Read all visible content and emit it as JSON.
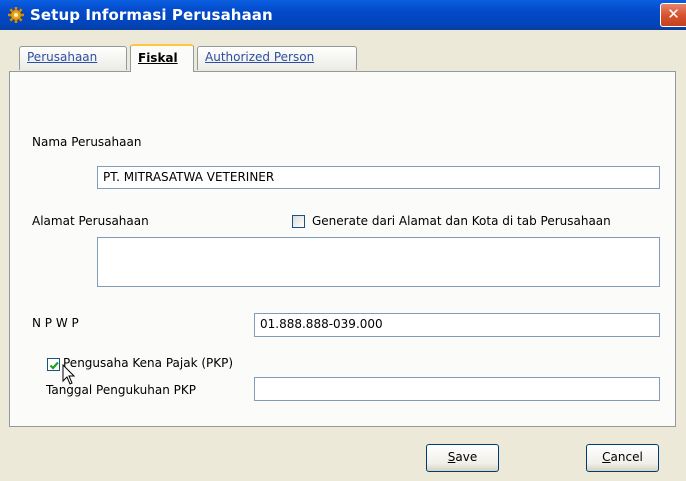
{
  "window": {
    "title": "Setup Informasi Perusahaan",
    "close_glyph": "✕",
    "app_icon": "gear-app-icon"
  },
  "tabs": [
    {
      "label": "Perusahaan",
      "active": false
    },
    {
      "label": "Fiskal",
      "active": true
    },
    {
      "label": "Authorized Person",
      "active": false
    }
  ],
  "form": {
    "nama_label": "Nama Perusahaan",
    "nama_value": "PT. MITRASATWA VETERINER",
    "alamat_label": "Alamat Perusahaan",
    "generate_label": "Generate dari Alamat dan Kota di tab Perusahaan",
    "generate_checked": false,
    "alamat_value": "",
    "npwp_label": "N P W P",
    "npwp_value": "01.888.888-039.000",
    "pkp_label": "Pengusaha Kena Pajak (PKP)",
    "pkp_checked": true,
    "tanggal_label": "Tanggal Pengukuhan PKP",
    "tanggal_value": ""
  },
  "buttons": {
    "save_mnemonic": "S",
    "save_rest": "ave",
    "cancel_mnemonic": "C",
    "cancel_rest": "ancel"
  },
  "colors": {
    "titlebar": "#0348c8",
    "close": "#d5512e",
    "tab_highlight": "#ffc83c",
    "checkmark": "#21a121"
  }
}
